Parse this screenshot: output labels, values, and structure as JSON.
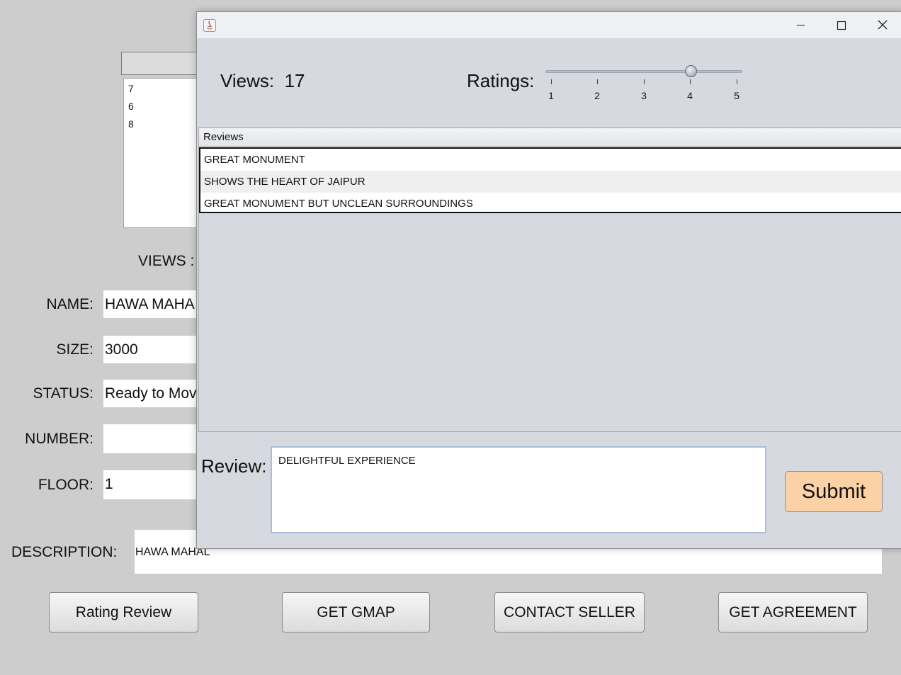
{
  "background": {
    "list_items": [
      "7",
      "6",
      "8"
    ],
    "views_label": "VIEWS :",
    "name_label": "NAME:",
    "name_value": "HAWA MAHA",
    "size_label": "SIZE:",
    "size_value": "3000",
    "status_label": "STATUS:",
    "status_value": "Ready to Mov",
    "number_label": "NUMBER:",
    "number_value": "",
    "floor_label": "FLOOR:",
    "floor_value": "1",
    "description_label": "DESCRIPTION:",
    "description_value": "HAWA MAHAL",
    "buttons": {
      "rating_review": "Rating Review",
      "get_gmap": "GET GMAP",
      "contact_seller": "CONTACT SELLER",
      "get_agreement": "GET AGREEMENT"
    }
  },
  "popup": {
    "views_label": "Views:",
    "views_value": "17",
    "ratings_label": "Ratings:",
    "slider": {
      "min": 1,
      "max": 5,
      "value": 4,
      "ticks": [
        "1",
        "2",
        "3",
        "4",
        "5"
      ]
    },
    "table": {
      "header": "Reviews",
      "rows": [
        "GREAT MONUMENT",
        "SHOWS THE HEART OF JAIPUR",
        "GREAT MONUMENT BUT UNCLEAN SURROUNDINGS"
      ]
    },
    "review_label": "Review:",
    "review_text": "DELIGHTFUL EXPERIENCE",
    "submit_label": "Submit"
  },
  "colors": {
    "submit_bg": "#fcd1a5",
    "window_bg": "#d6d9df",
    "desktop_bg": "#cdcdcd"
  },
  "icons": [
    "java-app-icon",
    "minimize-icon",
    "maximize-icon",
    "close-icon"
  ]
}
